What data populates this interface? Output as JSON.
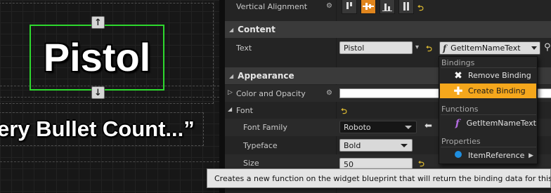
{
  "canvas": {
    "pistol_text": "Pistol",
    "bullet_text": "ery Bullet Count...”",
    "handle_up": "↑",
    "handle_down": "↓"
  },
  "details": {
    "vertical_alignment_label": "Vertical Alignment",
    "vertical_alignment_selected": "center",
    "content_category": "Content",
    "text_label": "Text",
    "text_value": "Pistol",
    "binding_function": "GetItemNameText",
    "appearance_category": "Appearance",
    "color_label": "Color and Opacity",
    "color_value": "#FFFFFF",
    "font_label": "Font",
    "font_family_label": "Font Family",
    "font_family_value": "Roboto",
    "typeface_label": "Typeface",
    "typeface_value": "Bold",
    "size_label": "Size",
    "size_value": "50"
  },
  "menu": {
    "bindings_header": "Bindings",
    "remove_binding": "Remove Binding",
    "create_binding": "Create Binding",
    "functions_header": "Functions",
    "function_item": "GetItemNameText",
    "properties_header": "Properties",
    "property_item": "ItemReference",
    "highlight_color": "#F5A71C"
  },
  "tooltip": {
    "text": "Creates a new function on the widget blueprint that will return the binding data for this property."
  },
  "colors": {
    "accent_orange": "#E0851D",
    "selection_green": "#2ED82E"
  }
}
